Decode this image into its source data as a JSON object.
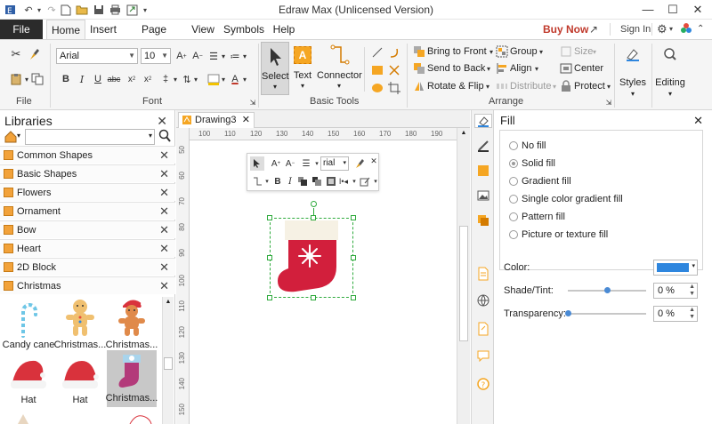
{
  "window": {
    "title": "Edraw Max (Unlicensed Version)",
    "buy_now": "Buy Now",
    "sign_in": "Sign In",
    "minimize": "—",
    "maximize": "☐",
    "close": "✕"
  },
  "tabs": {
    "file": "File",
    "items": [
      "Home",
      "Insert",
      "Page Layout",
      "View",
      "Symbols",
      "Help"
    ]
  },
  "ribbon": {
    "font_name": "Arial",
    "font_size": "10",
    "groups": {
      "file": "File",
      "font": "Font",
      "basic_tools": "Basic Tools",
      "arrange": "Arrange"
    },
    "tools": {
      "select": "Select",
      "text": "Text",
      "connector": "Connector"
    },
    "arrange": {
      "bring_to_front": "Bring to Front",
      "send_to_back": "Send to Back",
      "rotate_flip": "Rotate & Flip",
      "group": "Group",
      "align": "Align",
      "distribute": "Distribute",
      "size": "Size",
      "center": "Center",
      "protect": "Protect"
    },
    "styles": "Styles",
    "editing": "Editing"
  },
  "libraries": {
    "title": "Libraries",
    "categories": [
      "Common Shapes",
      "Basic Shapes",
      "Flowers",
      "Ornament",
      "Bow",
      "Heart",
      "2D Block",
      "Christmas"
    ],
    "thumbnails": [
      {
        "caption": "Candy cane",
        "icon": "candy-cane-icon"
      },
      {
        "caption": "Christmas...",
        "icon": "gingerbread-man-icon"
      },
      {
        "caption": "Christmas...",
        "icon": "gingerbread-santa-icon"
      },
      {
        "caption": "Hat",
        "icon": "santa-hat-icon"
      },
      {
        "caption": "Hat",
        "icon": "santa-hat-icon"
      },
      {
        "caption": "Christmas...",
        "icon": "christmas-stocking-icon"
      }
    ]
  },
  "document": {
    "tab": "Drawing3",
    "ruler_h": [
      "100",
      "110",
      "120",
      "130",
      "140",
      "150",
      "160",
      "170",
      "180",
      "190",
      "200"
    ],
    "ruler_v": [
      "50",
      "60",
      "70",
      "80",
      "90",
      "100",
      "110",
      "120",
      "130",
      "140",
      "150"
    ]
  },
  "mini_toolbar": {
    "font": "rial"
  },
  "fill_panel": {
    "title": "Fill",
    "options": [
      "No fill",
      "Solid fill",
      "Gradient fill",
      "Single color gradient fill",
      "Pattern fill",
      "Picture or texture fill"
    ],
    "selected": "Solid fill",
    "color_label": "Color:",
    "color_value": "#2e86de",
    "shade_label": "Shade/Tint:",
    "shade_value": "0 %",
    "transparency_label": "Transparency:",
    "transparency_value": "0 %",
    "shade_level": 0.5,
    "transparency_level": 0.0
  },
  "colors": {
    "accent_red": "#c0392b",
    "stocking_red": "#d21f3c",
    "handle_green": "#2eaa3c"
  }
}
